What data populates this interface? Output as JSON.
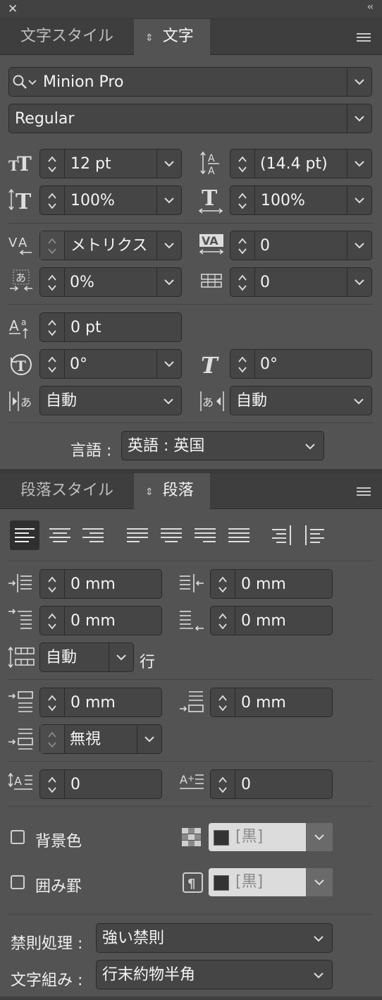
{
  "panel": {
    "close_glyph": "✕",
    "collapse_glyph": "‹‹"
  },
  "char_tabs": {
    "inactive": "文字スタイル",
    "active": "文字",
    "active_icon": "⇕"
  },
  "character": {
    "font_family": "Minion Pro",
    "font_style": "Regular",
    "font_size": "12 pt",
    "leading": "(14.4 pt)",
    "vertical_scale": "100%",
    "horizontal_scale": "100%",
    "kerning": "メトリクス",
    "tracking": "0",
    "tsume": "0%",
    "aki": "0",
    "baseline_shift": "0 pt",
    "character_rotation": "0°",
    "skew": "0°",
    "aki_before": "自動",
    "aki_after": "自動",
    "language_label": "言語 :",
    "language": "英語 : 英国"
  },
  "para_tabs": {
    "inactive": "段落スタイル",
    "active": "段落",
    "active_icon": "⇕"
  },
  "paragraph": {
    "left_indent": "0 mm",
    "right_indent": "0 mm",
    "first_line_indent": "0 mm",
    "last_line_right_indent": "0 mm",
    "grid_lines": "自動",
    "grid_lines_unit": "行",
    "space_before": "0 mm",
    "space_after": "0 mm",
    "grid_align": "無視",
    "drop_cap_lines": "0",
    "drop_cap_chars": "0",
    "shading_label": "背景色",
    "shading_color": "[黒]",
    "border_label": "囲み罫",
    "border_color": "[黒]",
    "kinsoku_label": "禁則処理 :",
    "kinsoku": "強い禁則",
    "mojikumi_label": "文字組み :",
    "mojikumi": "行末約物半角"
  },
  "colors": {
    "panel_bg": "#535353",
    "field_bg": "#454545",
    "tab_bar": "#3e3e3e",
    "swatch_black": "#333333",
    "swatch_field": "#dcdcdc"
  }
}
